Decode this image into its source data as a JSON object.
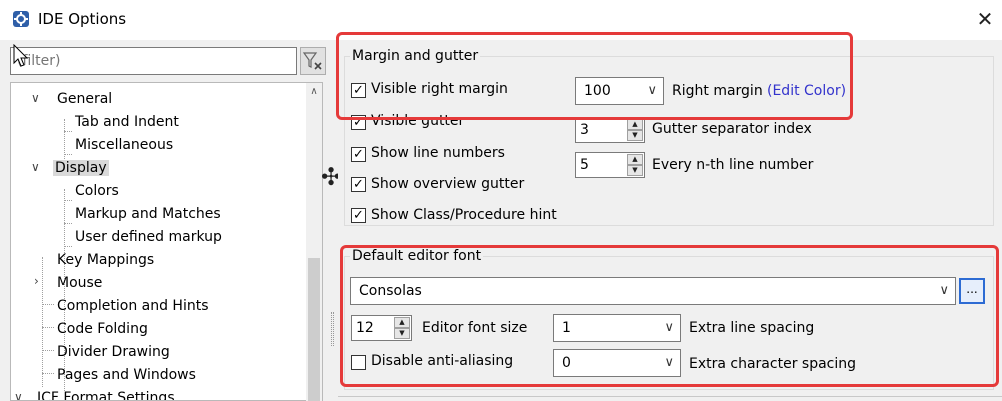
{
  "window": {
    "title": "IDE Options",
    "close_glyph": "✕"
  },
  "filter": {
    "placeholder": "(filter)",
    "clear_icon": "filter-clear-icon"
  },
  "tree": {
    "items": [
      {
        "label": "General",
        "expanded": true
      },
      {
        "label": "Tab and Indent"
      },
      {
        "label": "Miscellaneous"
      },
      {
        "label": "Display",
        "expanded": true,
        "selected": true
      },
      {
        "label": "Colors"
      },
      {
        "label": "Markup and Matches"
      },
      {
        "label": "User defined markup"
      },
      {
        "label": "Key Mappings"
      },
      {
        "label": "Mouse",
        "collapsed": true
      },
      {
        "label": "Completion and Hints"
      },
      {
        "label": "Code Folding"
      },
      {
        "label": "Divider Drawing"
      },
      {
        "label": "Pages and Windows"
      },
      {
        "label": "JCF Format Settings",
        "expanded": true
      }
    ]
  },
  "margin_gutter": {
    "title": "Margin and gutter",
    "visible_right_margin": {
      "label": "Visible right margin",
      "checked": true
    },
    "visible_gutter": {
      "label": "Visible gutter",
      "checked": true
    },
    "show_line_numbers": {
      "label": "Show line numbers",
      "checked": true
    },
    "show_overview_gutter": {
      "label": "Show overview gutter",
      "checked": true
    },
    "show_class_hint": {
      "label": "Show Class/Procedure hint",
      "checked": true
    },
    "right_margin": {
      "value": "100",
      "label": "Right margin",
      "link": "(Edit Color)"
    },
    "gutter_separator": {
      "value": "3",
      "label": "Gutter separator index"
    },
    "every_nth": {
      "value": "5",
      "label": "Every n-th line number"
    }
  },
  "editor_font": {
    "title": "Default editor font",
    "font_name": "Consolas",
    "browse_label": "...",
    "font_size": {
      "value": "12",
      "label": "Editor font size"
    },
    "extra_line_spacing": {
      "value": "1",
      "label": "Extra line spacing"
    },
    "disable_aa": {
      "label": "Disable anti-aliasing",
      "checked": false
    },
    "extra_char_spacing": {
      "value": "0",
      "label": "Extra character spacing"
    }
  },
  "colors": {
    "highlight_border": "#e53a3a",
    "link": "#3333cc",
    "focus": "#2d6bd3"
  }
}
